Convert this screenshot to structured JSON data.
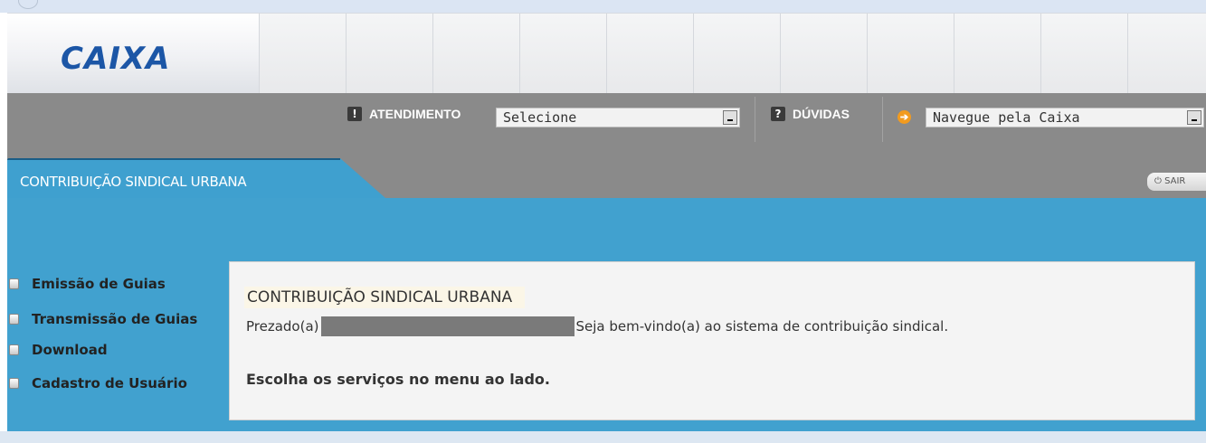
{
  "header": {
    "logo_text": "CAIXA"
  },
  "toolbar": {
    "atendimento_label": "ATENDIMENTO",
    "atendimento_select": "Selecione",
    "duvidas_label": "DÚVIDAS",
    "navegue_select": "Navegue pela Caixa",
    "icon_exclaim": "!",
    "icon_question": "?",
    "icon_arrow": "➔"
  },
  "tab": {
    "label": "CONTRIBUIÇÃO SINDICAL URBANA",
    "sair_label": "SAIR"
  },
  "menu": {
    "items": [
      {
        "label": "Emissão de Guias"
      },
      {
        "label": "Transmissão de Guias"
      },
      {
        "label": "Download"
      },
      {
        "label": "Cadastro de Usuário"
      }
    ]
  },
  "content": {
    "title": "CONTRIBUIÇÃO SINDICAL URBANA",
    "greeting_prefix": "Prezado(a)",
    "greeting_suffix": "Seja bem-vindo(a) ao sistema de contribuição sindical.",
    "instruction": "Escolha os serviços no menu ao lado."
  },
  "colors": {
    "brand_blue": "#1c56a6",
    "panel_blue": "#41a1cf",
    "toolbar_gray": "#8a8a8a",
    "accent_orange": "#f29b1f"
  }
}
